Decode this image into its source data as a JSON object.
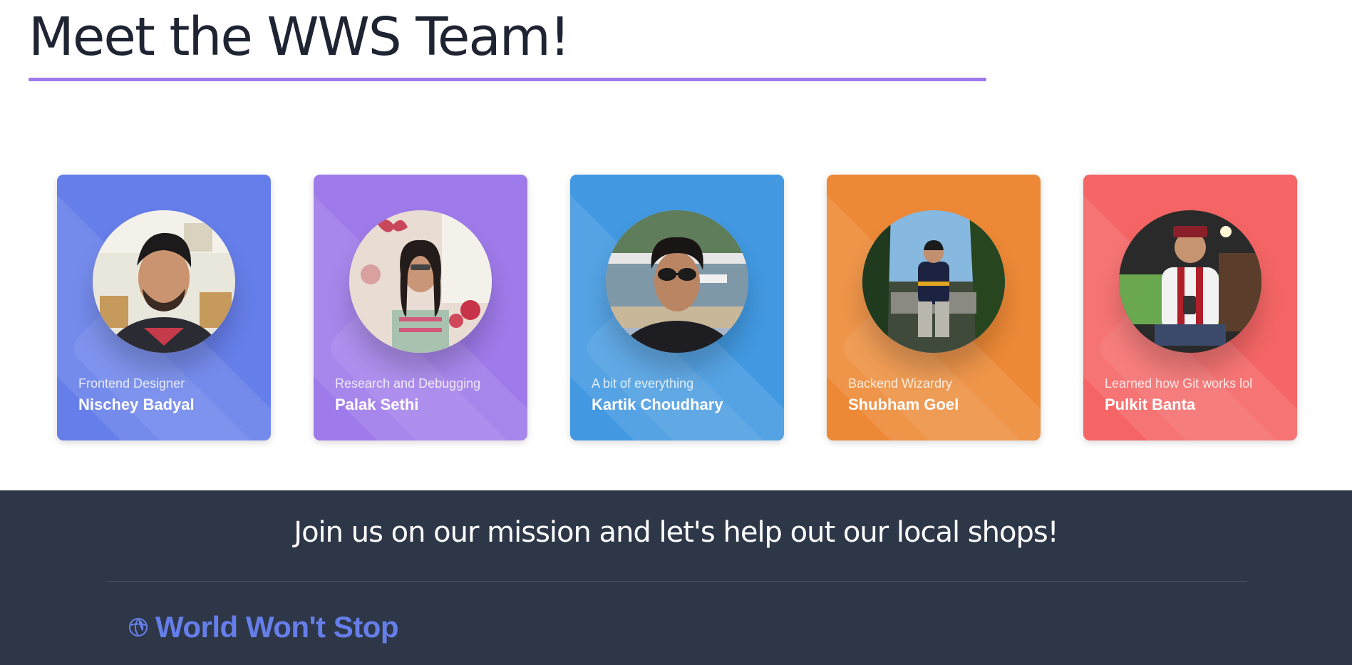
{
  "header": {
    "title": "Meet the WWS Team!",
    "accent_color": "#9f7aea"
  },
  "team": [
    {
      "role": "Frontend Designer",
      "name": "Nischey Badyal",
      "card_color": "#667eea",
      "photo": "portrait-photo"
    },
    {
      "role": "Research and Debugging",
      "name": "Palak Sethi",
      "card_color": "#9f7aea",
      "photo": "portrait-photo"
    },
    {
      "role": "A bit of everything",
      "name": "Kartik Choudhary",
      "card_color": "#4299e1",
      "photo": "portrait-photo"
    },
    {
      "role": "Backend Wizardry",
      "name": "Shubham Goel",
      "card_color": "#ed8936",
      "photo": "portrait-photo"
    },
    {
      "role": "Learned how Git works lol",
      "name": "Pulkit Banta",
      "card_color": "#f56565",
      "photo": "portrait-photo"
    }
  ],
  "footer": {
    "tagline": "Join us on our mission and let's help out our local shops!",
    "brand_name": "World Won't Stop",
    "brand_icon": "globe-icon",
    "background_color": "#2d3748",
    "brand_color": "#667eea"
  }
}
